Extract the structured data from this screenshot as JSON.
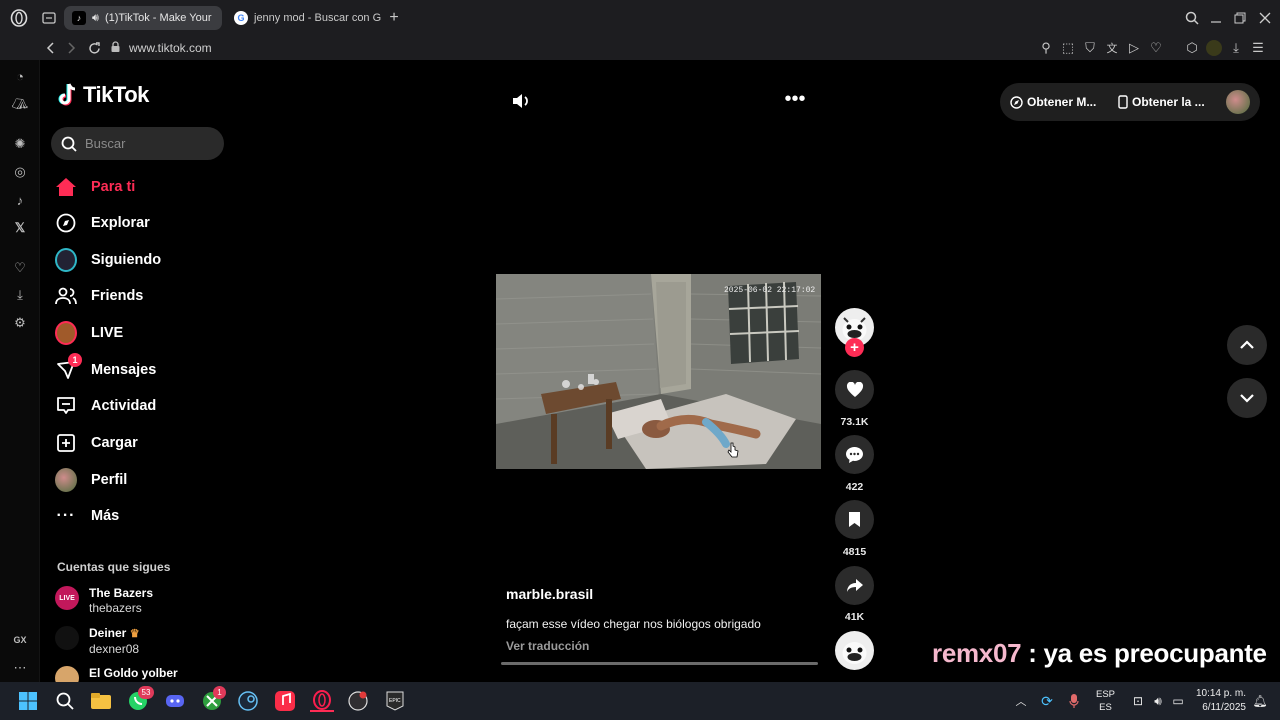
{
  "browser": {
    "tabs": [
      {
        "title": "(1)TikTok - Make Your",
        "active": true
      },
      {
        "title": "jenny mod - Buscar con G",
        "active": false
      }
    ],
    "new_tab_label": "+",
    "url": "www.tiktok.com"
  },
  "tiktok": {
    "logo_text": "TikTok",
    "search": {
      "placeholder": "Buscar"
    },
    "nav": [
      {
        "label": "Para ti",
        "active": true
      },
      {
        "label": "Explorar"
      },
      {
        "label": "Siguiendo"
      },
      {
        "label": "Friends"
      },
      {
        "label": "LIVE"
      },
      {
        "label": "Mensajes",
        "badge": "1"
      },
      {
        "label": "Actividad"
      },
      {
        "label": "Cargar"
      },
      {
        "label": "Perfil"
      },
      {
        "label": "Más"
      }
    ],
    "following_title": "Cuentas que sigues",
    "accounts": [
      {
        "name": "The Bazers",
        "handle": "thebazers"
      },
      {
        "name": "Deiner",
        "handle": "dexner08"
      },
      {
        "name": "El Goldo yolber",
        "handle": ""
      }
    ],
    "top_right": {
      "get_app_1": "Obtener M...",
      "get_app_2": "Obtener la ..."
    },
    "video": {
      "timestamp": "2025-06-02 22:17:02",
      "author": "marble.brasil",
      "caption": "façam esse vídeo chegar nos biólogos obrigado",
      "translate": "Ver traducción"
    },
    "rail": {
      "likes": "73.1K",
      "comments": "422",
      "saves": "4815",
      "shares": "41K"
    },
    "overlay": {
      "user": "remx07",
      "sep": " : ",
      "message": "ya es preocupante"
    }
  },
  "taskbar": {
    "whatsapp_badge": "53",
    "xbox_badge": "1",
    "lang_top": "ESP",
    "lang_bottom": "ES",
    "time": "10:14 p. m.",
    "date": "6/11/2025"
  },
  "opera_sidebar": {
    "gx_label": "GX"
  },
  "colors": {
    "accent": "#fe2c55",
    "overlay_user": "#f5b8cd"
  }
}
